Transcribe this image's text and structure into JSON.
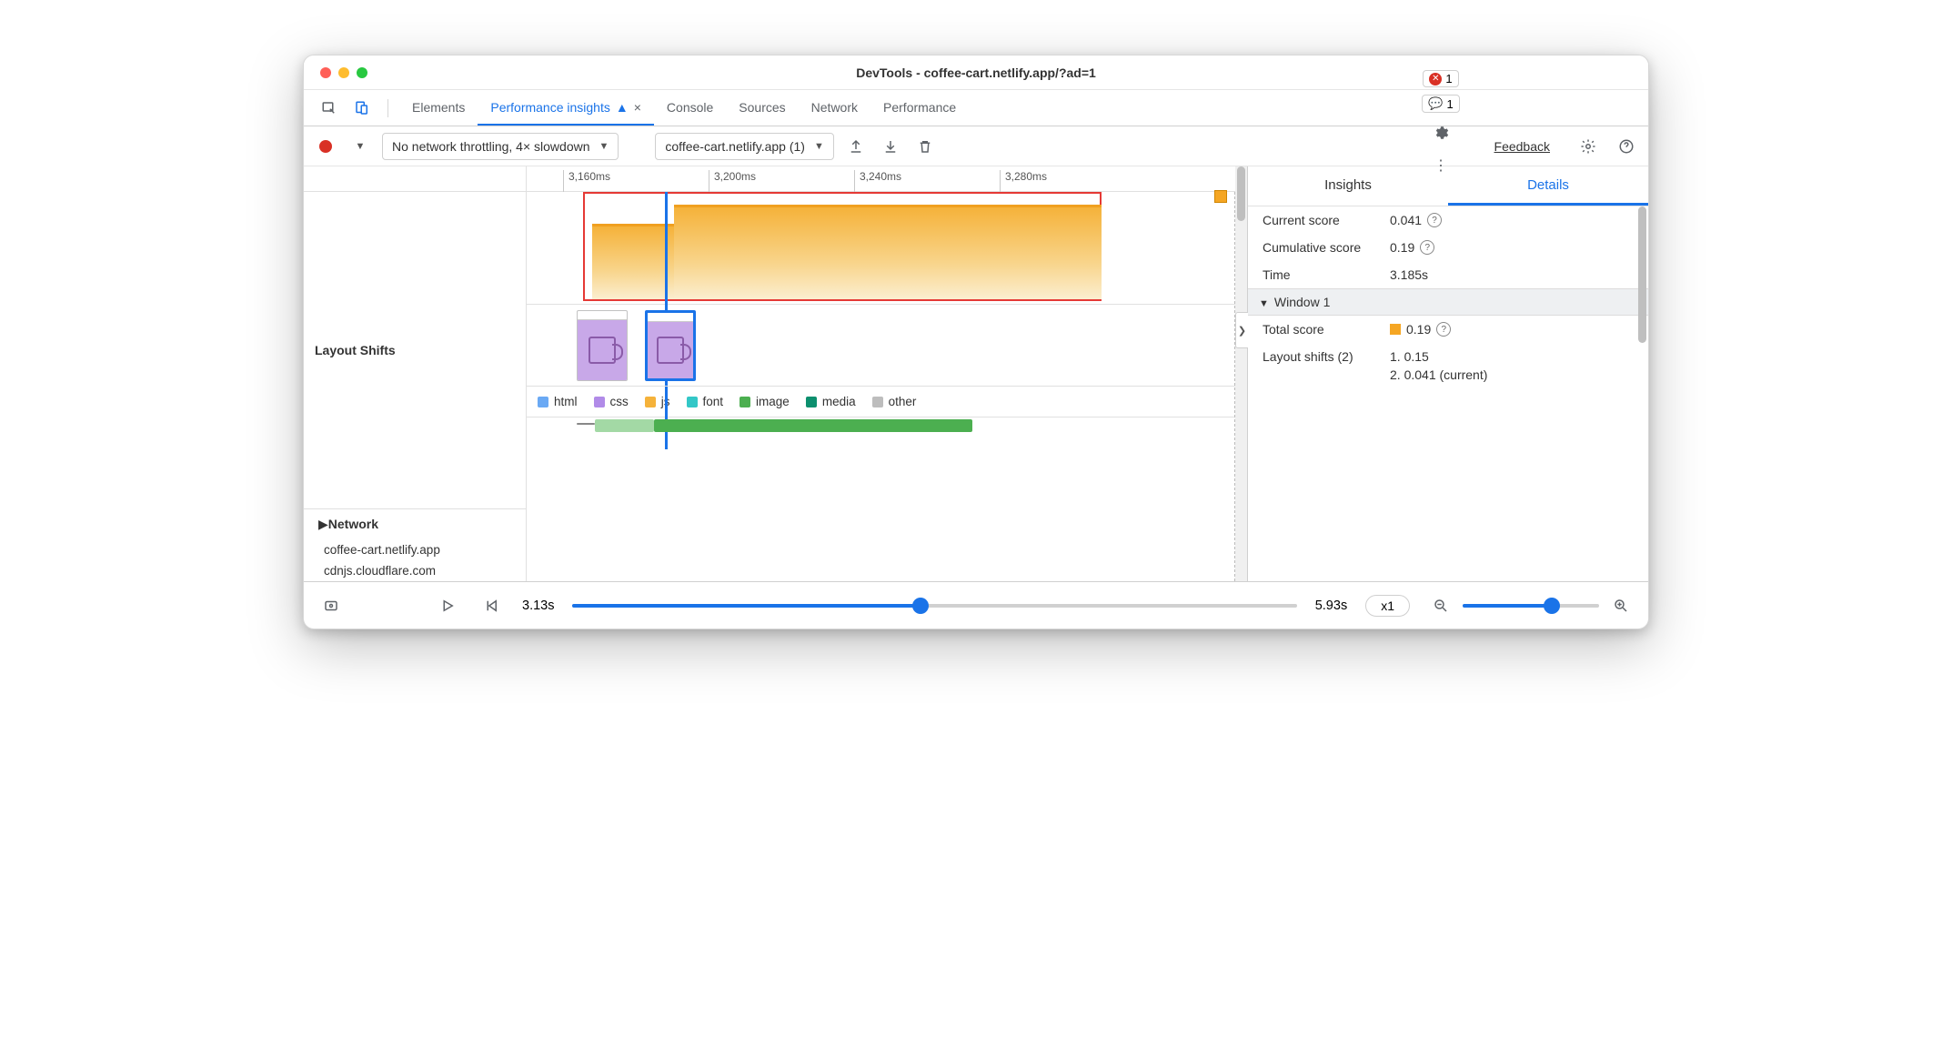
{
  "window": {
    "title": "DevTools - coffee-cart.netlify.app/?ad=1"
  },
  "tabs": {
    "items": [
      "Elements",
      "Performance insights",
      "Console",
      "Sources",
      "Network",
      "Performance"
    ],
    "active_index": 1,
    "flask_beta": true,
    "error_count": "1",
    "message_count": "1"
  },
  "toolbar": {
    "throttling": "No network throttling, 4× slowdown",
    "recording": "coffee-cart.netlify.app (1)",
    "feedback": "Feedback"
  },
  "timeline": {
    "ruler": [
      "3,160ms",
      "3,200ms",
      "3,240ms",
      "3,280ms"
    ],
    "section_label": "Layout Shifts",
    "network_label": "Network",
    "hosts": [
      "coffee-cart.netlify.app",
      "cdnjs.cloudflare.com"
    ],
    "legend": [
      {
        "label": "html",
        "color": "#6aa9f4"
      },
      {
        "label": "css",
        "color": "#b18be8"
      },
      {
        "label": "js",
        "color": "#f5b23a"
      },
      {
        "label": "font",
        "color": "#33c7c7"
      },
      {
        "label": "image",
        "color": "#4caf50"
      },
      {
        "label": "media",
        "color": "#0c8f6e"
      },
      {
        "label": "other",
        "color": "#bdbdbd"
      }
    ]
  },
  "details": {
    "tabs": [
      "Insights",
      "Details"
    ],
    "active": 1,
    "current_score_label": "Current score",
    "current_score": "0.041",
    "cumulative_score_label": "Cumulative score",
    "cumulative_score": "0.19",
    "time_label": "Time",
    "time": "3.185s",
    "window_header": "Window 1",
    "total_score_label": "Total score",
    "total_score": "0.19",
    "layout_shifts_label": "Layout shifts (2)",
    "shift_1": "1. 0.15",
    "shift_2": "2. 0.041 (current)"
  },
  "playback": {
    "start": "3.13s",
    "end": "5.93s",
    "speed": "x1"
  }
}
